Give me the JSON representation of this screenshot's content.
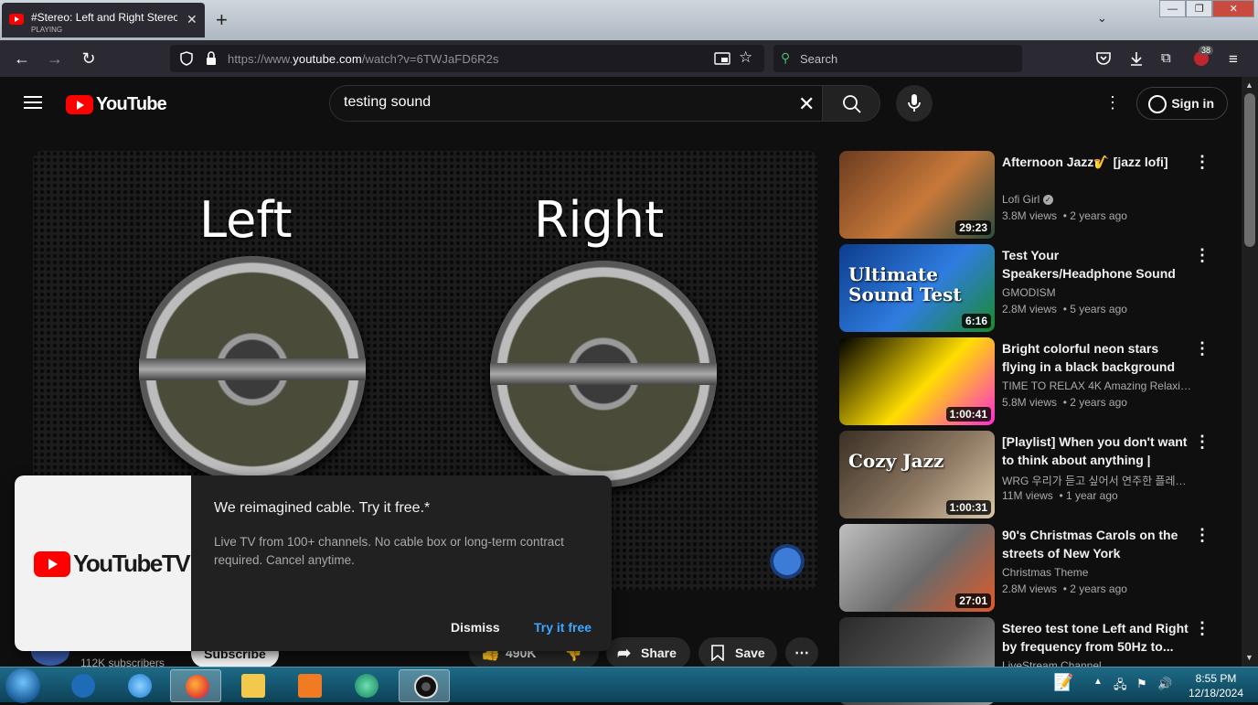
{
  "browser": {
    "tab_title": "#Stereo: Left and Right Stereo S",
    "tab_status": "PLAYING",
    "tab_close": "✕",
    "new_tab": "+",
    "tab_list": "⌄",
    "win_controls": [
      "—",
      "❐",
      "✕"
    ],
    "url_prefix": "https://www.",
    "url_domain": "youtube.com",
    "url_path": "/watch?v=6TWJaFD6R2s",
    "search_placeholder": "Search",
    "notification_count": "38"
  },
  "youtube": {
    "logo_text": "YouTube",
    "search_query": "testing sound",
    "signin_label": "Sign in"
  },
  "video": {
    "left_label": "Left",
    "right_label": "Right"
  },
  "actions": {
    "subscribers": "112K subscribers",
    "subscribe": "Subscribe",
    "likes": "490K",
    "share": "Share",
    "save": "Save"
  },
  "popup": {
    "brand_text": "YouTubeTV",
    "headline": "We reimagined cable. Try it free.*",
    "description": "Live TV from 100+ channels. No cable box or long-term contract required. Cancel anytime.",
    "dismiss": "Dismiss",
    "try_free": "Try it free"
  },
  "recommendations": [
    {
      "title": "Afternoon Jazz🎷 [jazz lofi]",
      "channel": "Lofi Girl",
      "verified": true,
      "views": "3.8M views",
      "age": "2 years ago",
      "duration": "29:23",
      "thumb_colors": [
        "#6b3b1f",
        "#c8793a",
        "#2d4a3e"
      ]
    },
    {
      "title": "Test Your Speakers/Headphone Sound Test: Low/Mid/High, L/...",
      "channel": "GMODISM",
      "verified": false,
      "views": "2.8M views",
      "age": "5 years ago",
      "duration": "6:16",
      "thumb_text": "Ultimate Sound Test",
      "thumb_colors": [
        "#0d3c8c",
        "#2f7de0",
        "#1a8a2b"
      ]
    },
    {
      "title": "Bright colorful neon stars flying in a black background",
      "channel": "TIME TO RELAX 4K Amazing Relaxin...",
      "verified": false,
      "views": "5.8M views",
      "age": "2 years ago",
      "duration": "1:00:41",
      "thumb_colors": [
        "#000000",
        "#ffde00",
        "#ff2ad4"
      ]
    },
    {
      "title": "[Playlist] When you don't want to think about anything | Cozy...",
      "channel": "WRG 우리가 듣고 싶어서 연주한 플레이리스트",
      "verified": false,
      "views": "11M views",
      "age": "1 year ago",
      "duration": "1:00:31",
      "thumb_text": "Cozy Jazz",
      "thumb_colors": [
        "#3a3024",
        "#8a7560",
        "#d9c7a8"
      ]
    },
    {
      "title": "90's Christmas Carols on the streets of New York",
      "channel": "Christmas Theme",
      "verified": false,
      "views": "2.8M views",
      "age": "2 years ago",
      "duration": "27:01",
      "thumb_colors": [
        "#bfbfbf",
        "#6a6a6a",
        "#e05a2a"
      ]
    },
    {
      "title": "Stereo test tone Left and Right by frequency from 50Hz to...",
      "channel": "LiveStream Channel",
      "verified": false,
      "views": "",
      "age": "",
      "duration": "",
      "thumb_colors": [
        "#2a2a2a",
        "#555555",
        "#999999"
      ]
    }
  ],
  "taskbar": {
    "time": "8:55 PM",
    "date": "12/18/2024"
  },
  "colors": {
    "yt_red": "#ff0000",
    "link_blue": "#3ea6ff",
    "background": "#0f0f0f"
  }
}
